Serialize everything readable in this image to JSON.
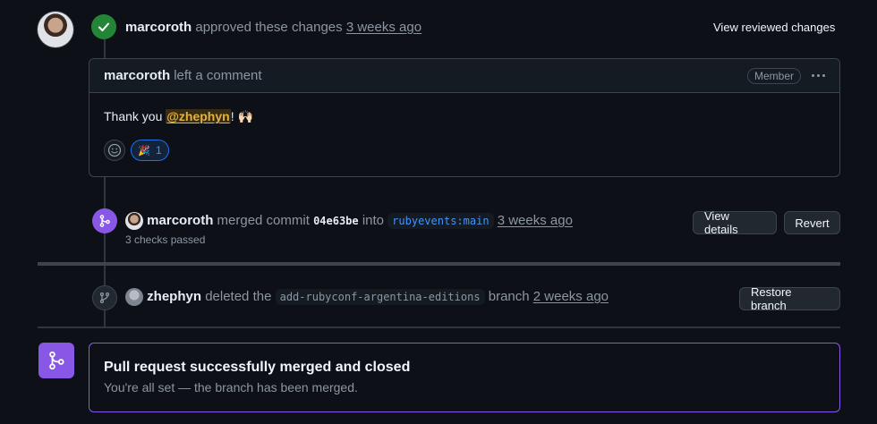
{
  "review": {
    "user": "marcoroth",
    "action": "approved these changes",
    "time": "3 weeks ago",
    "view_button": "View reviewed changes"
  },
  "comment": {
    "user": "marcoroth",
    "action": "left a comment",
    "role_badge": "Member",
    "body_prefix": "Thank you ",
    "mention": "@zhephyn",
    "body_suffix": "! 🙌🏻",
    "reaction_emoji": "🎉",
    "reaction_count": "1"
  },
  "merge_event": {
    "user": "marcoroth",
    "action": "merged commit",
    "commit": "04e63be",
    "into": "into",
    "branch": "rubyevents:main",
    "time": "3 weeks ago",
    "checks": "3 checks passed",
    "details_button": "View details",
    "revert_button": "Revert"
  },
  "delete_event": {
    "user": "zhephyn",
    "action": "deleted the",
    "branch": "add-rubyconf-argentina-editions",
    "branch_word": "branch",
    "time": "2 weeks ago",
    "restore_button": "Restore branch"
  },
  "merged_box": {
    "title": "Pull request successfully merged and closed",
    "subtitle": "You're all set — the branch has been merged."
  },
  "colors": {
    "approved_green": "#238636",
    "merged_purple": "#8957e5",
    "mention_yellow": "#e3b341",
    "reaction_blue": "#1f6feb"
  }
}
